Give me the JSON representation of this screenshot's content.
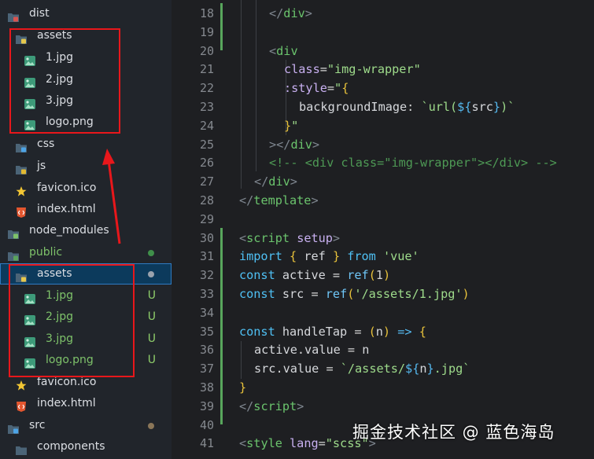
{
  "explorer": {
    "rows": [
      {
        "name": "dist",
        "icon": "dist-folder-icon",
        "status": "",
        "dot": ""
      },
      {
        "name": "assets",
        "icon": "assets-folder-icon",
        "status": "",
        "dot": ""
      },
      {
        "name": "1.jpg",
        "icon": "image-file-icon",
        "status": "",
        "dot": ""
      },
      {
        "name": "2.jpg",
        "icon": "image-file-icon",
        "status": "",
        "dot": ""
      },
      {
        "name": "3.jpg",
        "icon": "image-file-icon",
        "status": "",
        "dot": ""
      },
      {
        "name": "logo.png",
        "icon": "image-file-icon",
        "status": "",
        "dot": ""
      },
      {
        "name": "css",
        "icon": "css-folder-icon",
        "status": "",
        "dot": ""
      },
      {
        "name": "js",
        "icon": "js-folder-icon",
        "status": "",
        "dot": ""
      },
      {
        "name": "favicon.ico",
        "icon": "star-icon",
        "status": "",
        "dot": ""
      },
      {
        "name": "index.html",
        "icon": "html-file-icon",
        "status": "",
        "dot": ""
      },
      {
        "name": "node_modules",
        "icon": "node-folder-icon",
        "status": "",
        "dot": ""
      },
      {
        "name": "public",
        "icon": "public-folder-icon",
        "status": "",
        "dot": "#3f8f4a"
      },
      {
        "name": "assets",
        "icon": "assets-folder-icon",
        "status": "",
        "dot": "#9aa2ad"
      },
      {
        "name": "1.jpg",
        "icon": "image-file-icon",
        "status": "U",
        "dot": ""
      },
      {
        "name": "2.jpg",
        "icon": "image-file-icon",
        "status": "U",
        "dot": ""
      },
      {
        "name": "3.jpg",
        "icon": "image-file-icon",
        "status": "U",
        "dot": ""
      },
      {
        "name": "logo.png",
        "icon": "image-file-icon",
        "status": "U",
        "dot": ""
      },
      {
        "name": "favicon.ico",
        "icon": "star-icon",
        "status": "",
        "dot": ""
      },
      {
        "name": "index.html",
        "icon": "html-file-icon",
        "status": "",
        "dot": ""
      },
      {
        "name": "src",
        "icon": "src-folder-icon",
        "status": "",
        "dot": "#8a7658"
      },
      {
        "name": "components",
        "icon": "components-folder-icon",
        "status": "",
        "dot": ""
      }
    ]
  },
  "editor": {
    "lines": [
      {
        "n": "18",
        "tokens": [
          [
            "tag",
            "</"
          ],
          [
            "tagname",
            "div"
          ],
          [
            "tag",
            ">"
          ]
        ]
      },
      {
        "n": "19",
        "tokens": []
      },
      {
        "n": "20",
        "tokens": [
          [
            "tag",
            "<"
          ],
          [
            "tagname",
            "div"
          ]
        ]
      },
      {
        "n": "21",
        "tokens": [
          [
            "attr",
            "class"
          ],
          [
            "plain",
            "="
          ],
          [
            "str",
            "\"img-wrapper\""
          ]
        ]
      },
      {
        "n": "22",
        "tokens": [
          [
            "attr",
            ":style"
          ],
          [
            "plain",
            "="
          ],
          [
            "str",
            "\""
          ],
          [
            "brace",
            "{"
          ]
        ]
      },
      {
        "n": "23",
        "tokens": [
          [
            "var",
            "backgroundImage"
          ],
          [
            "plain",
            ": "
          ],
          [
            "str",
            "`url("
          ],
          [
            "op",
            "${"
          ],
          [
            "var",
            "src"
          ],
          [
            "op",
            "}"
          ],
          [
            "str",
            ")`"
          ]
        ]
      },
      {
        "n": "24",
        "tokens": [
          [
            "brace",
            "}"
          ],
          [
            "str",
            "\""
          ]
        ]
      },
      {
        "n": "25",
        "tokens": [
          [
            "tag",
            ">"
          ],
          [
            "tag",
            "</"
          ],
          [
            "tagname",
            "div"
          ],
          [
            "tag",
            ">"
          ]
        ]
      },
      {
        "n": "26",
        "tokens": [
          [
            "com",
            "<!-- <div class=\"img-wrapper\"></div> -->"
          ]
        ]
      },
      {
        "n": "27",
        "tokens": [
          [
            "tag",
            "</"
          ],
          [
            "tagname",
            "div"
          ],
          [
            "tag",
            ">"
          ]
        ]
      },
      {
        "n": "28",
        "tokens": [
          [
            "tag",
            "</"
          ],
          [
            "tagname",
            "template"
          ],
          [
            "tag",
            ">"
          ]
        ]
      },
      {
        "n": "29",
        "tokens": []
      },
      {
        "n": "30",
        "tokens": [
          [
            "tag",
            "<"
          ],
          [
            "tagname",
            "script"
          ],
          [
            "plain",
            " "
          ],
          [
            "attr",
            "setup"
          ],
          [
            "tag",
            ">"
          ]
        ]
      },
      {
        "n": "31",
        "tokens": [
          [
            "kw",
            "import"
          ],
          [
            "plain",
            " "
          ],
          [
            "brace",
            "{"
          ],
          [
            "plain",
            " "
          ],
          [
            "var",
            "ref"
          ],
          [
            "plain",
            " "
          ],
          [
            "brace",
            "}"
          ],
          [
            "plain",
            " "
          ],
          [
            "kw",
            "from"
          ],
          [
            "plain",
            " "
          ],
          [
            "str",
            "'vue'"
          ]
        ]
      },
      {
        "n": "32",
        "tokens": [
          [
            "kw",
            "const"
          ],
          [
            "plain",
            " "
          ],
          [
            "var",
            "active"
          ],
          [
            "plain",
            " = "
          ],
          [
            "fn",
            "ref"
          ],
          [
            "brace",
            "("
          ],
          [
            "plain",
            "1"
          ],
          [
            "brace",
            ")"
          ]
        ]
      },
      {
        "n": "33",
        "tokens": [
          [
            "kw",
            "const"
          ],
          [
            "plain",
            " "
          ],
          [
            "var",
            "src"
          ],
          [
            "plain",
            " = "
          ],
          [
            "fn",
            "ref"
          ],
          [
            "brace",
            "("
          ],
          [
            "str",
            "'/assets/1.jpg'"
          ],
          [
            "brace",
            ")"
          ]
        ]
      },
      {
        "n": "34",
        "tokens": []
      },
      {
        "n": "35",
        "tokens": [
          [
            "kw",
            "const"
          ],
          [
            "plain",
            " "
          ],
          [
            "var",
            "handleTap"
          ],
          [
            "plain",
            " = "
          ],
          [
            "brace",
            "("
          ],
          [
            "var",
            "n"
          ],
          [
            "brace",
            ")"
          ],
          [
            "plain",
            " "
          ],
          [
            "op",
            "=>"
          ],
          [
            "plain",
            " "
          ],
          [
            "brace",
            "{"
          ]
        ]
      },
      {
        "n": "36",
        "tokens": [
          [
            "var",
            "active"
          ],
          [
            "plain",
            "."
          ],
          [
            "var",
            "value"
          ],
          [
            "plain",
            " = "
          ],
          [
            "var",
            "n"
          ]
        ]
      },
      {
        "n": "37",
        "tokens": [
          [
            "var",
            "src"
          ],
          [
            "plain",
            "."
          ],
          [
            "var",
            "value"
          ],
          [
            "plain",
            " = "
          ],
          [
            "str",
            "`/assets/"
          ],
          [
            "op",
            "${"
          ],
          [
            "var",
            "n"
          ],
          [
            "op",
            "}"
          ],
          [
            "str",
            ".jpg`"
          ]
        ]
      },
      {
        "n": "38",
        "tokens": [
          [
            "brace",
            "}"
          ]
        ]
      },
      {
        "n": "39",
        "tokens": [
          [
            "tag",
            "</"
          ],
          [
            "tagname",
            "script"
          ],
          [
            "tag",
            ">"
          ]
        ]
      },
      {
        "n": "40",
        "tokens": []
      },
      {
        "n": "41",
        "tokens": [
          [
            "tag",
            "<"
          ],
          [
            "tagname",
            "style"
          ],
          [
            "plain",
            " "
          ],
          [
            "attr",
            "lang"
          ],
          [
            "plain",
            "="
          ],
          [
            "str",
            "\"scss\""
          ],
          [
            "tag",
            ">"
          ]
        ]
      }
    ]
  },
  "watermark": "掘金技术社区 @ 蓝色海岛",
  "colors": {
    "accent_red": "#e8171b",
    "selection": "#0c3a5c",
    "git_added": "#58a65c"
  }
}
